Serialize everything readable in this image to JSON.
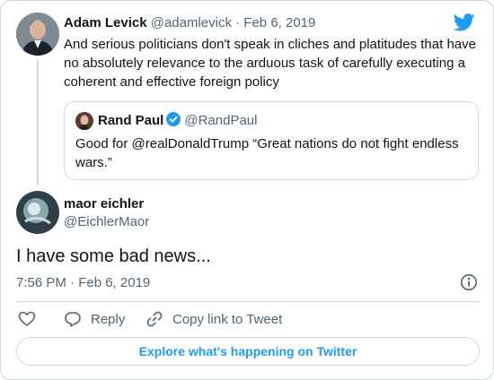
{
  "parent": {
    "author_name": "Adam Levick",
    "meta": "@adamlevick · Feb 6, 2019",
    "text": "And serious politicians don't speak in cliches and platitudes that have no absolutely relevance to the arduous task of carefully executing a coherent and effective foreign policy"
  },
  "quote": {
    "author_name": "Rand Paul",
    "handle": "@RandPaul",
    "text": "Good for @realDonaldTrump “Great nations do not fight endless wars.”"
  },
  "tweet": {
    "author_name": "maor eichler",
    "handle": "@EichlerMaor",
    "text": "I have some bad news...",
    "timestamp": "7:56 PM · Feb 6, 2019"
  },
  "actions": {
    "reply_label": "Reply",
    "copy_label": "Copy link to Tweet"
  },
  "explore_label": "Explore what's happening on Twitter",
  "colors": {
    "accent": "#1d9bf0",
    "secondary_text": "#536471",
    "border": "#cfd9de"
  },
  "icons": [
    "twitter-bird-icon",
    "verified-badge-icon",
    "info-icon",
    "heart-icon",
    "reply-icon",
    "link-icon"
  ]
}
